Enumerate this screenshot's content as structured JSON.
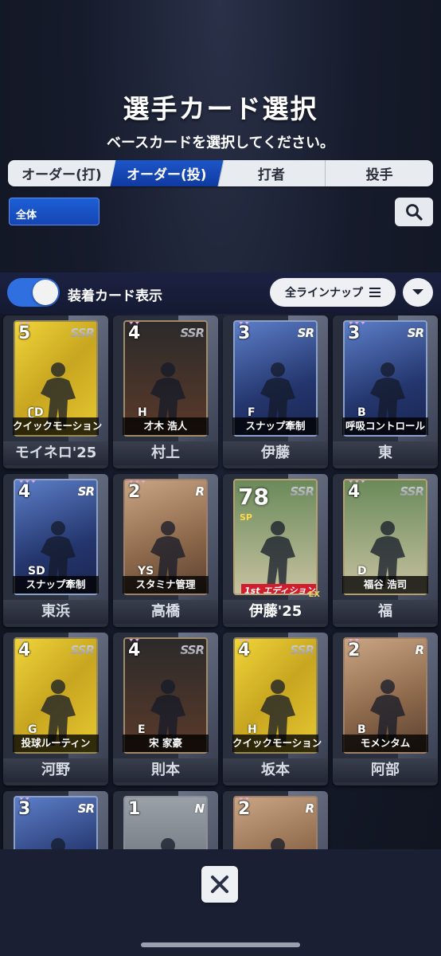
{
  "header": {
    "title": "選手カード選択",
    "subtitle": "ベースカードを選択してください。"
  },
  "tabs": [
    {
      "label": "オーダー(打)",
      "active": false
    },
    {
      "label": "オーダー(投)",
      "active": true
    },
    {
      "label": "打者",
      "active": false
    },
    {
      "label": "投手",
      "active": false
    }
  ],
  "filter": {
    "label": "全体"
  },
  "toolbar": {
    "toggle_label": "装着カード表示",
    "toggle_on": true,
    "lineup_label": "全ラインナップ"
  },
  "cards": [
    {
      "level": "5",
      "stars": "✦✦",
      "rarity": "SSR",
      "skill": "クイックモーション",
      "team": "ʗD",
      "name": "モイネロ'25"
    },
    {
      "level": "4",
      "stars": "✦✦",
      "rarity": "SSR",
      "skill": "才木 浩人",
      "team": "H",
      "name": "村上"
    },
    {
      "level": "3",
      "stars": "✦✦",
      "rarity": "SR",
      "skill": "スナップ牽制",
      "team": "F",
      "name": "伊藤"
    },
    {
      "level": "3",
      "stars": "✦✦✦",
      "rarity": "SR",
      "skill": "呼吸コントロール",
      "team": "B",
      "name": "東"
    },
    {
      "level": "4",
      "stars": "✦✦✦",
      "rarity": "SR",
      "skill": "スナップ牽制",
      "team": "SD",
      "name": "東浜"
    },
    {
      "level": "2",
      "stars": "✦✦✦",
      "rarity": "R",
      "skill": "スタミナ管理",
      "team": "YS",
      "name": "高橋"
    },
    {
      "level": "78",
      "stars": "",
      "rarity": "SSR",
      "skill": "",
      "team": "",
      "name": "伊藤'25",
      "sp": "SP",
      "edition": "1st エディション",
      "ex": "EX"
    },
    {
      "level": "4",
      "stars": "✦✦✦",
      "rarity": "SSR",
      "skill": "福谷 浩司",
      "team": "D",
      "name": "福"
    },
    {
      "level": "4",
      "stars": "✦",
      "rarity": "SSR",
      "skill": "投球ルーティン",
      "team": "G",
      "name": "河野"
    },
    {
      "level": "4",
      "stars": "✦✦",
      "rarity": "SSR",
      "skill": "宋 家豪",
      "team": "E",
      "name": "則本"
    },
    {
      "level": "4",
      "stars": "✦✦",
      "rarity": "SSR",
      "skill": "クイックモーション",
      "team": "H",
      "name": "坂本"
    },
    {
      "level": "2",
      "stars": "✦✦",
      "rarity": "R",
      "skill": "モメンタム",
      "team": "B",
      "name": "阿部"
    },
    {
      "level": "3",
      "stars": "✦✦",
      "rarity": "SR",
      "skill": "",
      "team": "",
      "name": ""
    },
    {
      "level": "1",
      "stars": "",
      "rarity": "N",
      "skill": "",
      "team": "",
      "name": ""
    },
    {
      "level": "2",
      "stars": "✦✦",
      "rarity": "R",
      "skill": "",
      "team": "",
      "name": ""
    }
  ],
  "colors": {
    "accent": "#1d56c8",
    "background": "#161b2c"
  },
  "icons": [
    "search-icon",
    "menu-lines-icon",
    "chevron-down-icon",
    "close-icon"
  ]
}
